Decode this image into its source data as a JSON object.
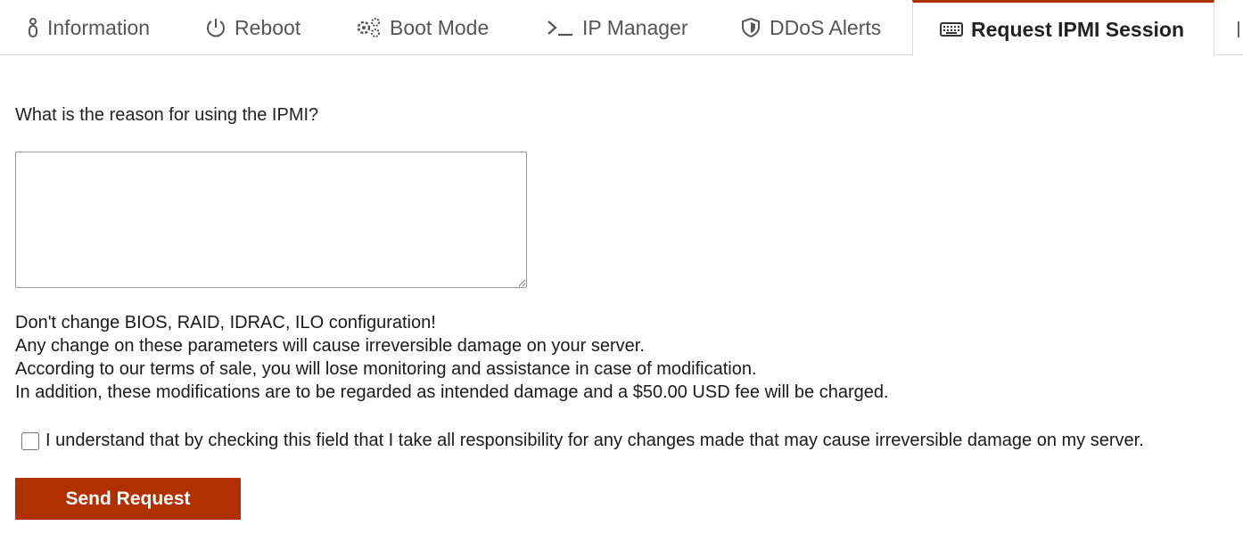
{
  "tabs": [
    {
      "label": "Information",
      "icon": "info-icon",
      "active": false
    },
    {
      "label": "Reboot",
      "icon": "power-icon",
      "active": false
    },
    {
      "label": "Boot Mode",
      "icon": "gears-icon",
      "active": false
    },
    {
      "label": "IP Manager",
      "icon": "terminal-icon",
      "active": false
    },
    {
      "label": "DDoS Alerts",
      "icon": "shield-icon",
      "active": false
    },
    {
      "label": "Request IPMI Session",
      "icon": "keyboard-icon",
      "active": true
    }
  ],
  "form": {
    "question": "What is the reason for using the IPMI?",
    "reason_value": "",
    "warning_lines": [
      "Don't change BIOS, RAID, IDRAC, ILO configuration!",
      "Any change on these parameters will cause irreversible damage on your server.",
      "According to our terms of sale, you will lose monitoring and assistance in case of modification.",
      "In addition, these modifications are to be regarded as intended damage and a $50.00 USD fee will be charged."
    ],
    "agreement_label": "I understand that by checking this field that I take all responsibility for any changes made that may cause irreversible damage on my server.",
    "agreement_checked": false,
    "submit_label": "Send Request"
  },
  "colors": {
    "accent": "#b03000",
    "tab_text": "#555555",
    "border": "#dcdcdc"
  }
}
